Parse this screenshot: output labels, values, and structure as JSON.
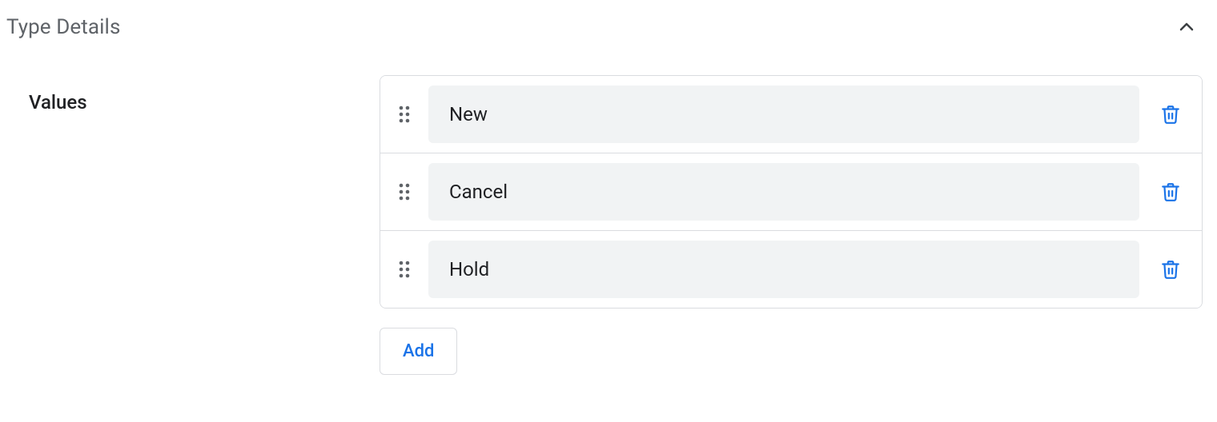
{
  "section": {
    "title": "Type Details"
  },
  "values": {
    "label": "Values",
    "items": [
      {
        "text": "New"
      },
      {
        "text": "Cancel"
      },
      {
        "text": "Hold"
      }
    ],
    "add_label": "Add"
  }
}
